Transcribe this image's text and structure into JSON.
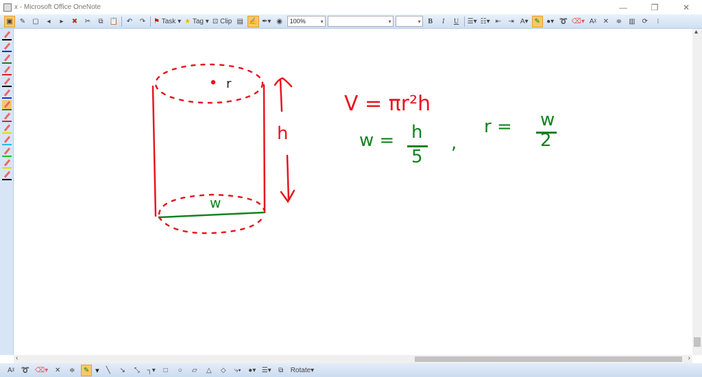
{
  "window": {
    "title": "x - Microsoft Office OneNote",
    "minimize": "—",
    "restore": "❐",
    "close": "✕"
  },
  "toolbar": {
    "task": "Task",
    "tag": "Tag",
    "clip": "Clip",
    "zoom": "100%",
    "font": "",
    "size": "",
    "bold": "B",
    "italic": "I",
    "underline": "U"
  },
  "drawing_toolbar": {
    "rotate": "Rotate"
  },
  "pens": [
    {
      "color": "#000000"
    },
    {
      "color": "#1030d0"
    },
    {
      "color": "#208020"
    },
    {
      "color": "#e02020"
    },
    {
      "color": "#000000"
    },
    {
      "color": "#1030d0"
    },
    {
      "color": "#208020",
      "active": true
    },
    {
      "color": "#e02020"
    },
    {
      "color": "#e0e000"
    },
    {
      "color": "#20c0e0"
    },
    {
      "color": "#20c020"
    },
    {
      "color": "#e0e000"
    },
    {
      "color": "#000000"
    }
  ],
  "ink": {
    "colors": {
      "red": "#e8141e",
      "green": "#12821e"
    },
    "labels": {
      "radius": "r",
      "height": "h",
      "width": "w"
    },
    "equations": {
      "volume": "V = πr²h",
      "width_eq_lhs": "w =",
      "width_eq_num": "h",
      "width_eq_den": "5",
      "comma": ",",
      "radius_eq_lhs": "r =",
      "radius_eq_num": "w",
      "radius_eq_den": "2"
    }
  }
}
